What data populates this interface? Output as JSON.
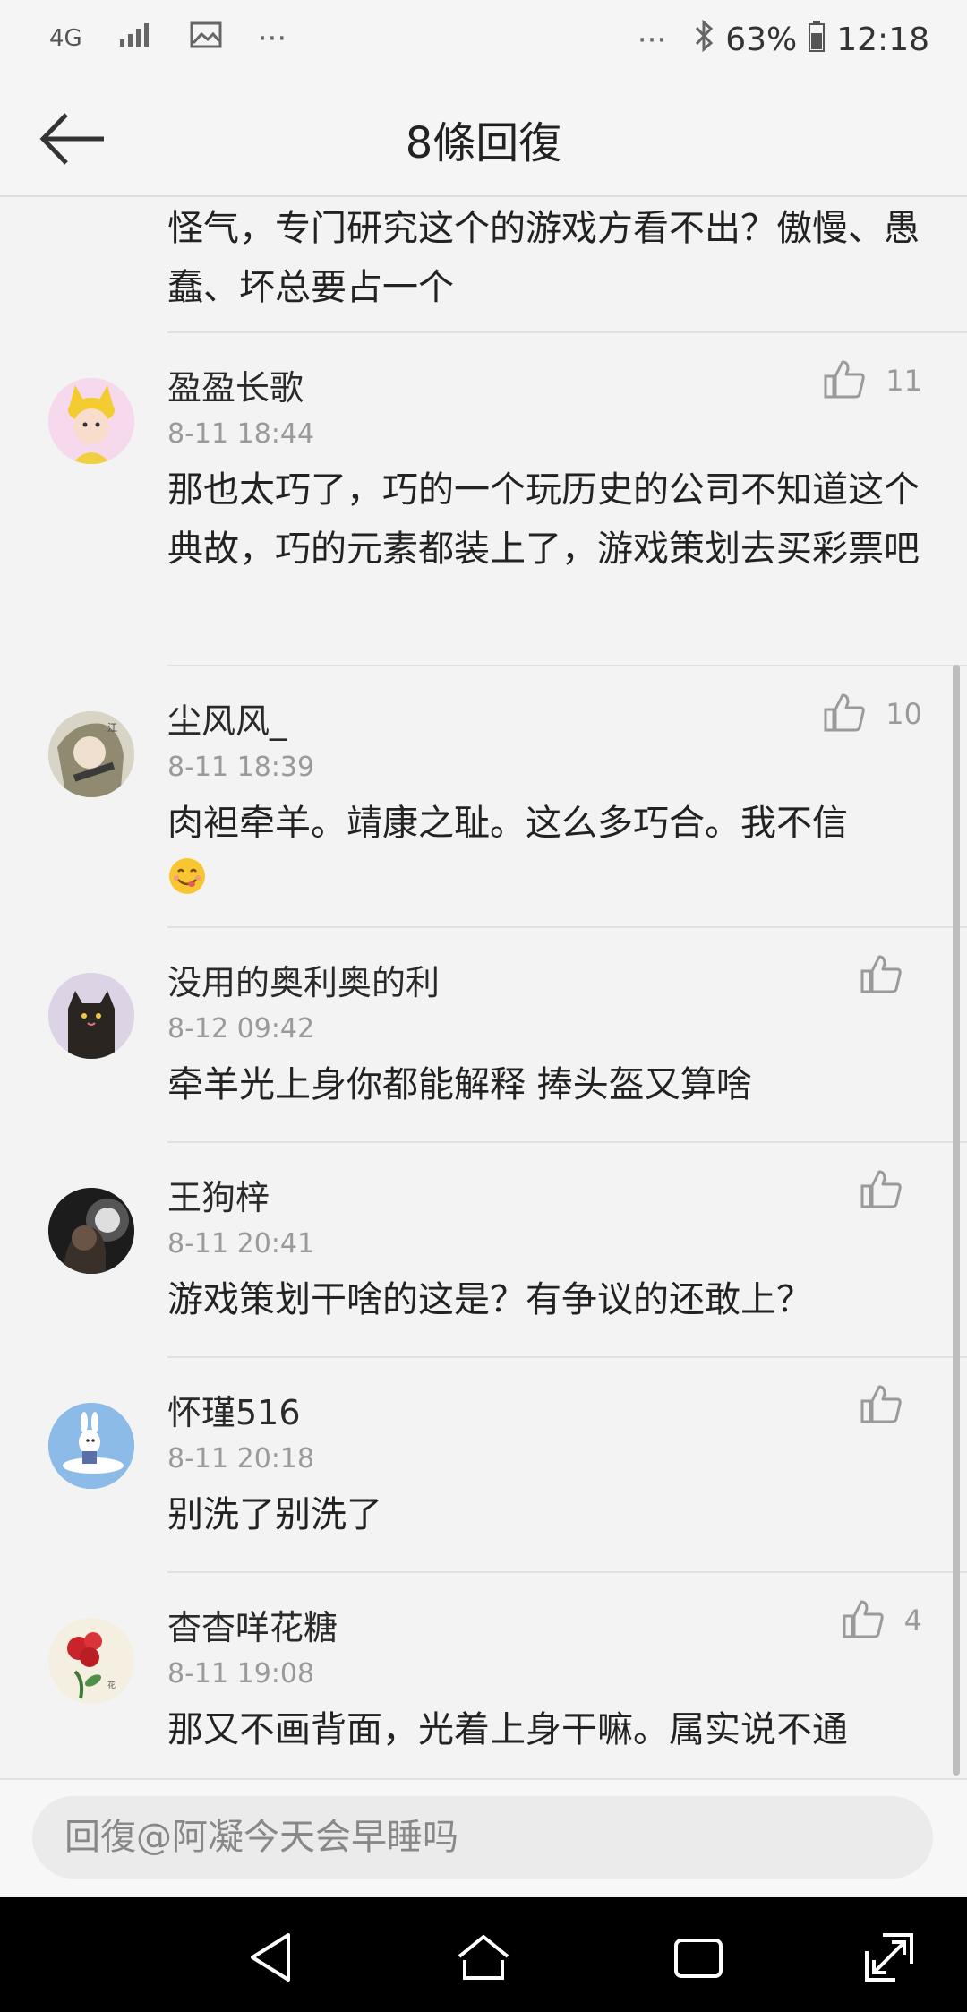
{
  "status_bar": {
    "network": "4G",
    "more": "···",
    "right_more": "···",
    "battery": "63%",
    "time": "12:18"
  },
  "header": {
    "title": "8條回復"
  },
  "partial_comment": {
    "text": "怪气，专门研究这个的游戏方看不出？傲慢、愚蠢、坏总要占一个"
  },
  "comments": [
    {
      "username": "盈盈长歌",
      "time": "8-11 18:44",
      "text": "那也太巧了，巧的一个玩历史的公司不知道这个典故，巧的元素都装上了，游戏策划去买彩票吧",
      "likes": "11"
    },
    {
      "username": "尘风风_",
      "time": "8-11 18:39",
      "text": "肉袒牵羊。靖康之耻。这么多巧合。我不信",
      "likes": "10"
    },
    {
      "username": "没用的奥利奥的利",
      "time": "8-12 09:42",
      "text": "牵羊光上身你都能解释  捧头盔又算啥",
      "likes": ""
    },
    {
      "username": "王狗梓",
      "time": "8-11 20:41",
      "text": "游戏策划干啥的这是？有争议的还敢上？",
      "likes": ""
    },
    {
      "username": "怀瑾516",
      "time": "8-11 20:18",
      "text": "别洗了别洗了",
      "likes": ""
    },
    {
      "username": "杳杳咩花糖",
      "time": "8-11 19:08",
      "text": "那又不画背面，光着上身干嘛。属实说不通",
      "likes": "4"
    }
  ],
  "reply": {
    "placeholder": "回復@阿凝今天会早睡吗"
  },
  "icons": {
    "back": "arrow-left-icon",
    "like": "thumbs-up-icon",
    "emoji": "yum-face-emoji"
  },
  "colors": {
    "background": "#f3f3f3",
    "text": "#222222",
    "secondary": "#9a9a9a",
    "nav_bar": "#000000"
  }
}
